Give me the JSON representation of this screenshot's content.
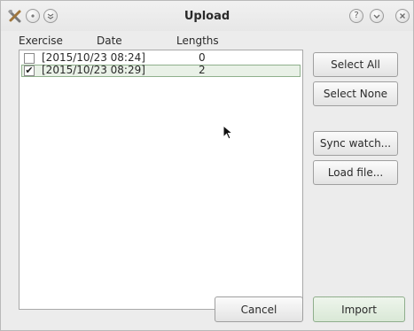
{
  "window": {
    "title": "Upload"
  },
  "titlebar": {
    "left_icons": [
      "app-tools-icon",
      "minimize-icon",
      "shade-icon"
    ],
    "right_icons": [
      "help-icon",
      "roll-down-icon",
      "close-icon"
    ]
  },
  "columns": {
    "exercise": "Exercise",
    "date": "Date",
    "lengths": "Lengths"
  },
  "rows": [
    {
      "date": "[2015/10/23 08:24]",
      "lengths": "0",
      "checked": false,
      "check_glyph": ""
    },
    {
      "date": "[2015/10/23 08:29]",
      "lengths": "2",
      "checked": true,
      "check_glyph": "✔"
    }
  ],
  "buttons": {
    "select_all": "Select All",
    "select_none": "Select None",
    "sync_watch": "Sync watch...",
    "load_file": "Load file...",
    "cancel": "Cancel",
    "import": "Import"
  },
  "colors": {
    "selection_bg": "#e9f1e7",
    "selection_border": "#8fb08c",
    "import_bg": "#d9e8d6"
  }
}
